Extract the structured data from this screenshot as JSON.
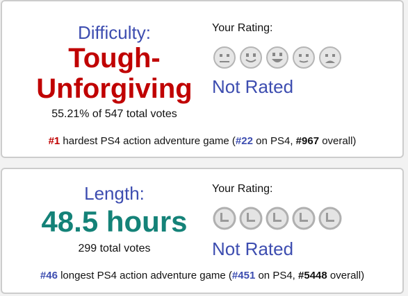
{
  "difficulty": {
    "label": "Difficulty:",
    "value_line1": "Tough-",
    "value_line2": "Unforgiving",
    "votes": "55.21% of 547 total votes",
    "your_rating": "Your Rating:",
    "not_rated": "Not Rated",
    "rank": {
      "num": "#1",
      "text1": " hardest PS4 action adventure game (",
      "platform_num": "#22",
      "text2": " on PS4, ",
      "overall_num": "#967",
      "text3": " overall)"
    },
    "icons": [
      "straight-face-icon",
      "smile-face-icon",
      "grin-face-icon",
      "slight-smile-face-icon",
      "frown-face-icon"
    ],
    "value_color": "#c00000"
  },
  "length": {
    "label": "Length:",
    "value": "48.5 hours",
    "votes": "299 total votes",
    "your_rating": "Your Rating:",
    "not_rated": "Not Rated",
    "rank": {
      "num": "#46",
      "text1": " longest PS4 action adventure game (",
      "platform_num": "#451",
      "text2": " on PS4, ",
      "overall_num": "#5448",
      "text3": " overall)"
    },
    "icons": [
      "clock-icon",
      "clock-icon",
      "clock-icon",
      "clock-icon",
      "clock-icon"
    ],
    "value_color": "#148278"
  },
  "colors": {
    "accent_blue": "#3d4db0",
    "difficulty_red": "#c00000",
    "length_teal": "#148278",
    "icon_gray": "#c8c8c8"
  }
}
